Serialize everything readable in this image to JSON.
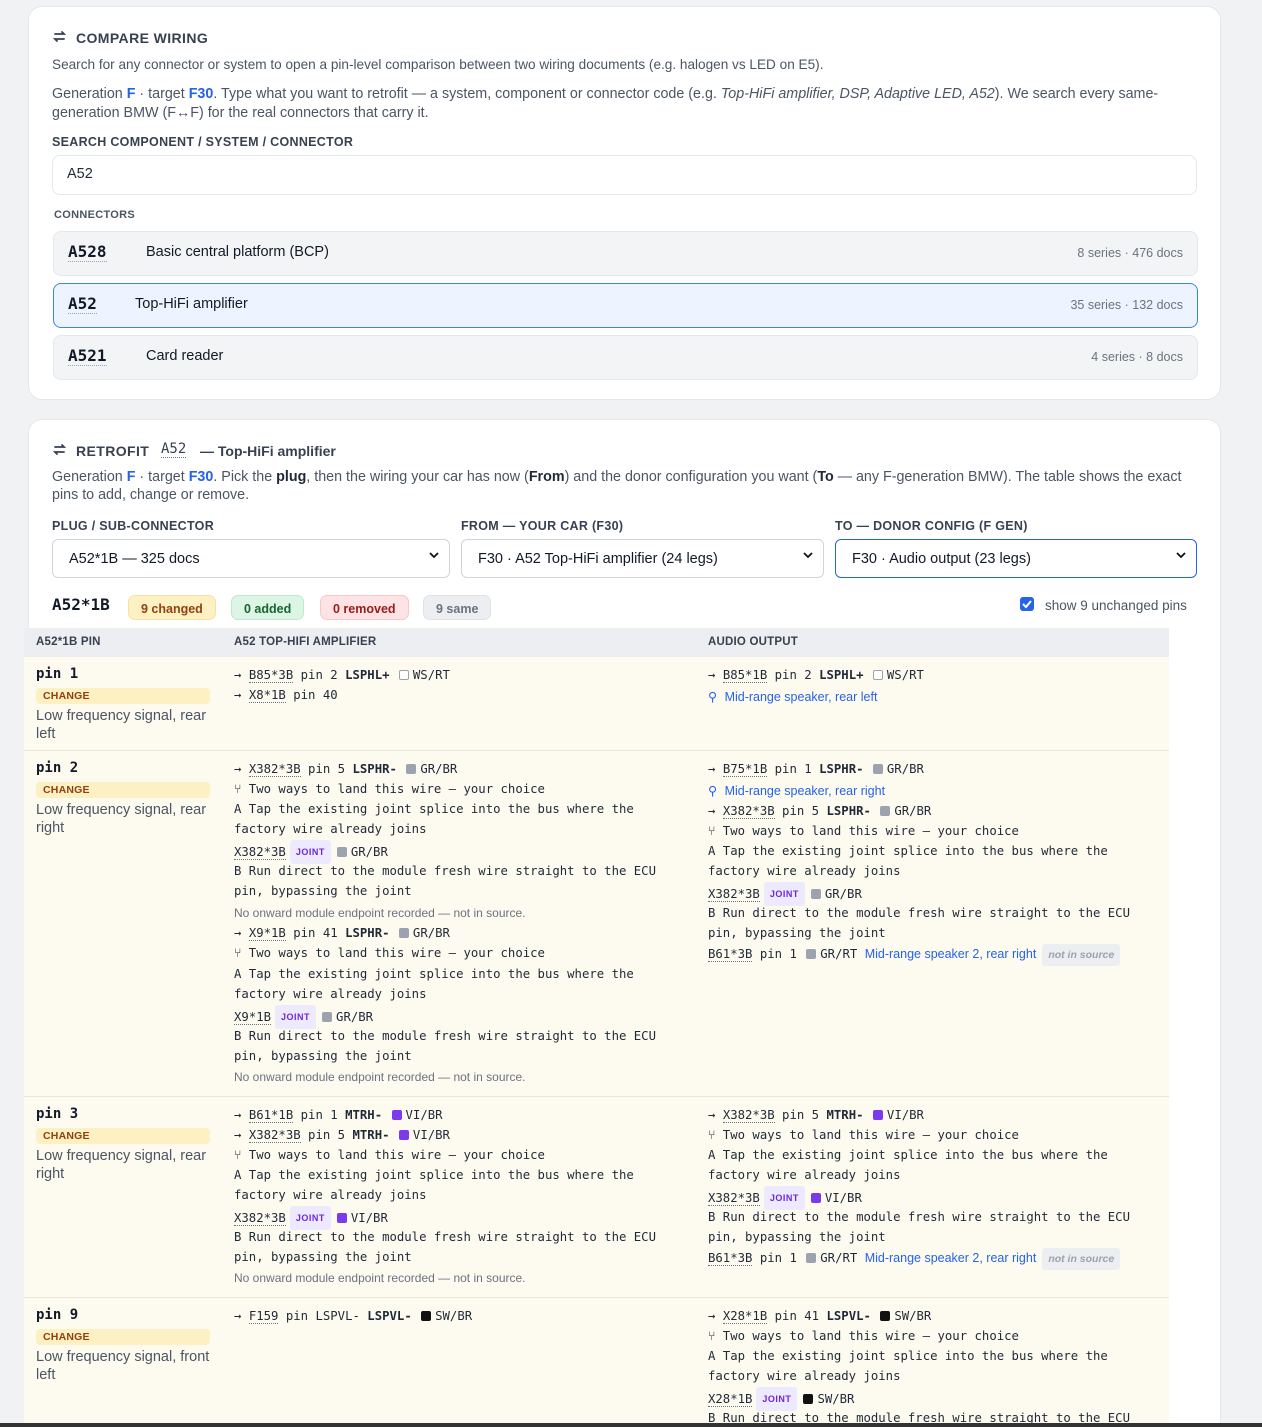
{
  "compare": {
    "icon": "swap-icon",
    "title": "COMPARE WIRING",
    "subtitle": "Search for any connector or system to open a pin-level comparison between two wiring documents (e.g. halogen vs LED on E5).",
    "gen_prefix": "Generation ",
    "gen": "F",
    "target_prefix": " · target ",
    "target": "F30",
    "desc_a": ". Type what you want to retrofit — a system, component or connector code (e.g. ",
    "desc_examples": "Top-HiFi amplifier, DSP, Adaptive LED, A52",
    "desc_b": "). We search every same-generation BMW (F↔F) for the real connectors that carry it.",
    "search_label": "SEARCH COMPONENT / SYSTEM / CONNECTOR",
    "search_value": "A52",
    "connectors_label": "CONNECTORS",
    "results": [
      {
        "code": "A528",
        "name": "Basic central platform (BCP)",
        "meta": "8 series · 476 docs"
      },
      {
        "code": "A52",
        "name": "Top-HiFi amplifier",
        "meta": "35 series · 132 docs"
      },
      {
        "code": "A521",
        "name": "Card reader",
        "meta": "4 series · 8 docs"
      }
    ]
  },
  "retrofit": {
    "icon": "swap-icon",
    "title": "RETROFIT",
    "code": "A52",
    "name": "— Top-HiFi amplifier",
    "gen_prefix": "Generation ",
    "gen": "F",
    "target_prefix": " · target ",
    "target": "F30",
    "d1": ". Pick the ",
    "d_plug": "plug",
    "d2": ", then the wiring your car has now (",
    "d_from": "From",
    "d3": ") and the donor configuration you want (",
    "d_to": "To",
    "d4": " — any F-generation BMW). The table shows the exact pins to add, change or remove.",
    "plug_label": "PLUG / SUB-CONNECTOR",
    "plug_value": "A52*1B — 325 docs",
    "from_label": "FROM — YOUR CAR (F30)",
    "from_value": "F30 · A52 Top-HiFi amplifier (24 legs)",
    "to_label": "TO — DONOR CONFIG (F GEN)",
    "to_value": "F30 · Audio output (23 legs)",
    "plug_code": "A52*1B",
    "badges": {
      "changed": "9 changed",
      "added": "0 added",
      "removed": "0 removed",
      "same": "9 same"
    },
    "show_unchanged": "show 9 unchanged pins",
    "show_unchanged_checked": true,
    "col_pin": "A52*1B PIN",
    "col_from": "A52 TOP-HIFI AMPLIFIER",
    "col_to": "AUDIO OUTPUT"
  },
  "common": {
    "arrow": "→",
    "pin_word": "pin",
    "two_ways": "Two ways to land this wire — your choice",
    "tap_a1": "A Tap the existing joint splice into the bus where the",
    "tap_a2": "factory wire already joins",
    "run_b1": "B Run direct to the module fresh wire straight to the ECU",
    "run_b2": "pin, bypassing the joint",
    "no_onward": "No onward module endpoint recorded — not in source.",
    "joint": "JOINT",
    "not_in_source": "not in source",
    "change": "CHANGE"
  },
  "colors": {
    "VI": "#7c3aed",
    "GR": "#9ca3af",
    "SW": "#111111",
    "WS": "#ffffff",
    "accent": "#2563eb",
    "change_bg": "#fdf0c3"
  },
  "pins": [
    {
      "pin": "pin 1",
      "desc": "Low frequency signal, rear left",
      "from": [
        {
          "conn": "B85*3B",
          "pin": "2",
          "sig": "LSPHL+",
          "color": "WS/RT"
        },
        {
          "conn": "X8*1B",
          "pin": "40"
        }
      ],
      "to": [
        {
          "conn": "B85*1B",
          "pin": "2",
          "sig": "LSPHL+",
          "color": "WS/RT"
        },
        {
          "location": "Mid-range speaker, rear left"
        }
      ]
    },
    {
      "pin": "pin 2",
      "desc": "Low frequency signal, rear right",
      "from": [
        {
          "conn": "X382*3B",
          "pin": "5",
          "sig": "LSPHR-",
          "color": "GR/BR",
          "joint": "X382*3B",
          "joint_color": "GR/BR"
        },
        {
          "conn": "X9*1B",
          "pin": "41",
          "sig": "LSPHR-",
          "color": "GR/BR",
          "joint": "X9*1B",
          "joint_color": "GR/BR"
        }
      ],
      "to": [
        {
          "conn": "B75*1B",
          "pin": "1",
          "sig": "LSPHR-",
          "color": "GR/BR",
          "location": "Mid-range speaker, rear right"
        },
        {
          "conn": "X382*3B",
          "pin": "5",
          "sig": "LSPHR-",
          "color": "GR/BR",
          "joint": "X382*3B",
          "joint_color": "GR/BR",
          "end_conn": "B61*3B",
          "end_pin": "1",
          "end_color": "GR/RT",
          "end_link": "Mid-range speaker 2, rear right"
        }
      ]
    },
    {
      "pin": "pin 3",
      "desc": "Low frequency signal, rear right",
      "from": [
        {
          "conn": "B61*1B",
          "pin": "1",
          "sig": "MTRH-",
          "color": "VI/BR"
        },
        {
          "conn": "X382*3B",
          "pin": "5",
          "sig": "MTRH-",
          "color": "VI/BR",
          "joint": "X382*3B",
          "joint_color": "VI/BR"
        }
      ],
      "to": [
        {
          "conn": "X382*3B",
          "pin": "5",
          "sig": "MTRH-",
          "color": "VI/BR",
          "joint": "X382*3B",
          "joint_color": "VI/BR",
          "end_conn": "B61*3B",
          "end_pin": "1",
          "end_color": "GR/RT",
          "end_link": "Mid-range speaker 2, rear right"
        }
      ]
    },
    {
      "pin": "pin 9",
      "desc": "Low frequency signal, front left",
      "from": [
        {
          "conn": "F159",
          "pin": "LSPVL-",
          "sig": "LSPVL-",
          "color": "SW/BR"
        }
      ],
      "to": [
        {
          "conn": "X28*1B",
          "pin": "41",
          "sig": "LSPVL-",
          "color": "SW/BR",
          "joint": "X28*1B",
          "joint_color": "SW/BR"
        }
      ]
    }
  ]
}
